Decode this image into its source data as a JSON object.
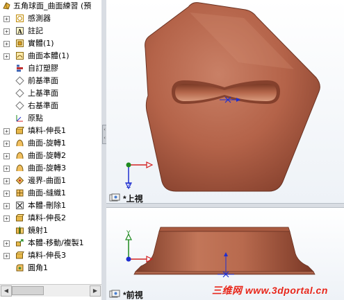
{
  "tree": {
    "root_label": "五角球面_曲面練習 (預",
    "items": [
      {
        "label": "感測器",
        "icon": "sensor-icon"
      },
      {
        "label": "註記",
        "icon": "annotation-icon"
      },
      {
        "label": "實體(1)",
        "icon": "solid-body-icon"
      },
      {
        "label": "曲面本體(1)",
        "icon": "surface-body-icon"
      },
      {
        "label": "自訂塑膠",
        "icon": "material-icon"
      },
      {
        "label": "前基準面",
        "icon": "plane-icon"
      },
      {
        "label": "上基準面",
        "icon": "plane-icon"
      },
      {
        "label": "右基準面",
        "icon": "plane-icon"
      },
      {
        "label": "原點",
        "icon": "origin-icon"
      },
      {
        "label": "填料-伸長1",
        "icon": "extrude-icon"
      },
      {
        "label": "曲面-旋轉1",
        "icon": "surface-revolve-icon"
      },
      {
        "label": "曲面-旋轉2",
        "icon": "surface-revolve-icon"
      },
      {
        "label": "曲面-旋轉3",
        "icon": "surface-revolve-icon"
      },
      {
        "label": "邊界-曲面1",
        "icon": "boundary-surface-icon"
      },
      {
        "label": "曲面-縫織1",
        "icon": "knit-surface-icon"
      },
      {
        "label": "本體-刪除1",
        "icon": "delete-body-icon"
      },
      {
        "label": "填料-伸長2",
        "icon": "extrude-icon"
      },
      {
        "label": "鏡射1",
        "icon": "mirror-icon"
      },
      {
        "label": "本體-移動/複製1",
        "icon": "move-copy-icon"
      },
      {
        "label": "填料-伸長3",
        "icon": "extrude-icon"
      },
      {
        "label": "圓角1",
        "icon": "fillet-icon"
      }
    ]
  },
  "viewports": {
    "top": {
      "label": "*上視",
      "axis_vertical": "Z"
    },
    "front": {
      "label": "*前視",
      "axis_vertical": "Y"
    }
  },
  "watermark": "三维网 www.3dportal.cn",
  "colors": {
    "model": "#b86a4e",
    "axis_red": "#d42020",
    "axis_green": "#1f8a1f",
    "axis_blue": "#1f2fd0",
    "watermark": "#e8261a"
  }
}
